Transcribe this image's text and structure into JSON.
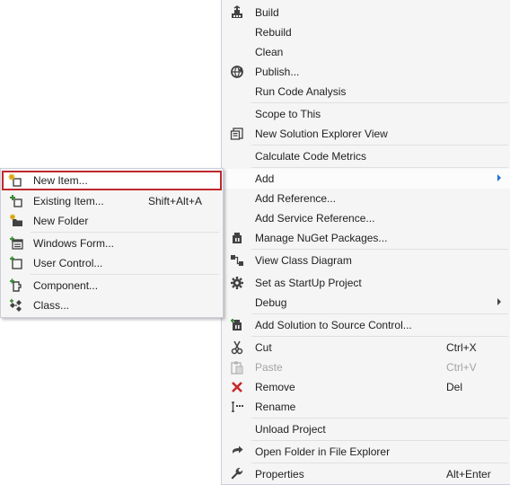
{
  "context_menu": {
    "items": [
      {
        "label": "Build",
        "icon": "build-icon"
      },
      {
        "label": "Rebuild"
      },
      {
        "label": "Clean"
      },
      {
        "label": "Publish...",
        "icon": "publish-icon"
      },
      {
        "label": "Run Code Analysis"
      },
      {
        "label": "Scope to This"
      },
      {
        "label": "New Solution Explorer View",
        "icon": "new-view-icon"
      },
      {
        "label": "Calculate Code Metrics"
      },
      {
        "label": "Add",
        "has_submenu": true
      },
      {
        "label": "Add Reference..."
      },
      {
        "label": "Add Service Reference..."
      },
      {
        "label": "Manage NuGet Packages...",
        "icon": "nuget-icon"
      },
      {
        "label": "View Class Diagram",
        "icon": "class-diagram-icon"
      },
      {
        "label": "Set as StartUp Project",
        "icon": "gear-icon"
      },
      {
        "label": "Debug",
        "has_submenu": true
      },
      {
        "label": "Add Solution to Source Control...",
        "icon": "source-control-icon"
      },
      {
        "label": "Cut",
        "shortcut": "Ctrl+X",
        "icon": "scissors-icon"
      },
      {
        "label": "Paste",
        "shortcut": "Ctrl+V",
        "icon": "paste-icon",
        "disabled": true
      },
      {
        "label": "Remove",
        "shortcut": "Del",
        "icon": "remove-icon"
      },
      {
        "label": "Rename",
        "icon": "rename-icon"
      },
      {
        "label": "Unload Project"
      },
      {
        "label": "Open Folder in File Explorer",
        "icon": "open-folder-icon"
      },
      {
        "label": "Properties",
        "shortcut": "Alt+Enter",
        "icon": "wrench-icon"
      }
    ]
  },
  "add_submenu": {
    "items": [
      {
        "label": "New Item...",
        "icon": "new-item-icon",
        "selected": true
      },
      {
        "label": "Existing Item...",
        "shortcut": "Shift+Alt+A",
        "icon": "existing-item-icon"
      },
      {
        "label": "New Folder",
        "icon": "new-folder-icon"
      },
      {
        "label": "Windows Form...",
        "icon": "windows-form-icon"
      },
      {
        "label": "User Control...",
        "icon": "user-control-icon"
      },
      {
        "label": "Component...",
        "icon": "component-icon"
      },
      {
        "label": "Class...",
        "icon": "class-icon"
      }
    ]
  },
  "colors": {
    "menu_background": "#f5f5f5",
    "selection_outline": "#c0282d",
    "submenu_arrow_active": "#1e76c8",
    "disabled_text": "#a2a4a5"
  }
}
